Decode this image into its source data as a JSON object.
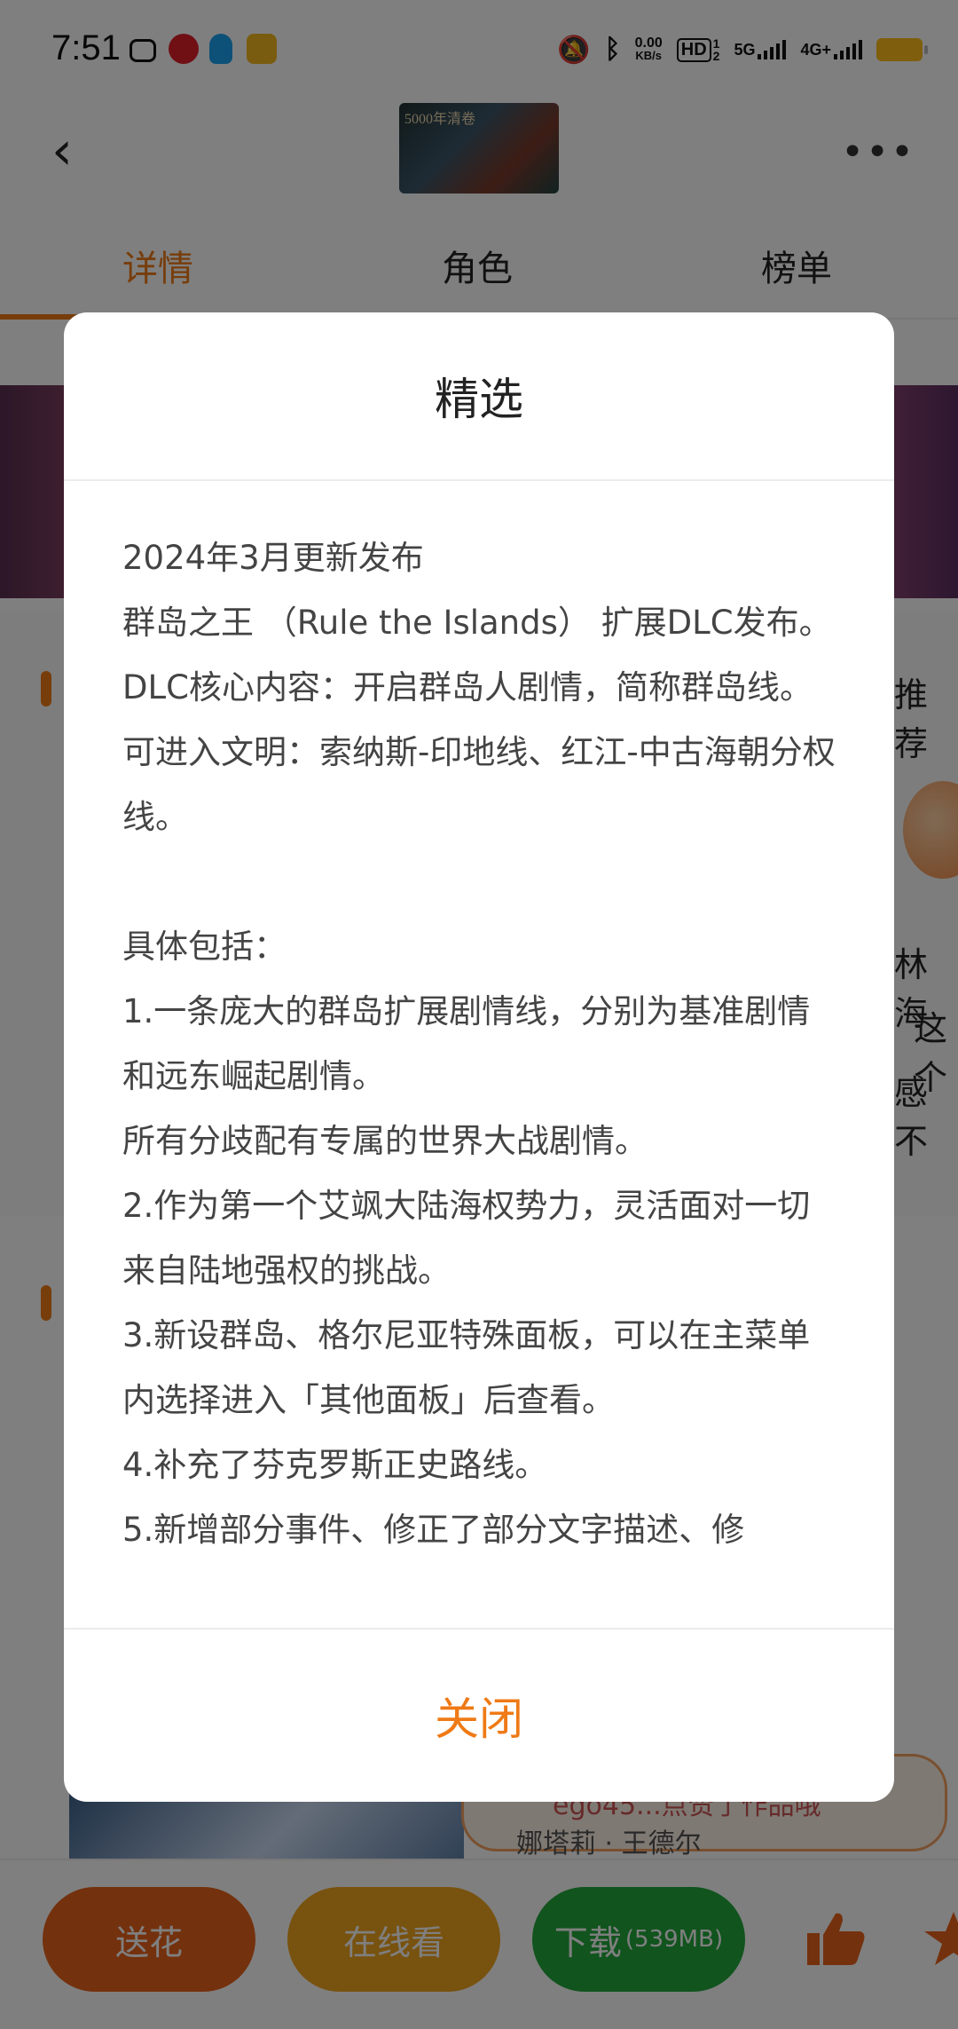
{
  "status_bar": {
    "time": "7:51",
    "net_speed_value": "0.00",
    "net_speed_unit": "KB/s",
    "hd_label": "HD",
    "hd_sub": "1",
    "hd_sub2": "2",
    "net_5g": "5G",
    "net_4g": "4G+",
    "app_icons": [
      "bilibili-icon",
      "netease-music-icon",
      "qq-icon",
      "weibo-icon"
    ],
    "battery_color": "#ffbf1a"
  },
  "header": {
    "cover_text": "5000年清卷"
  },
  "tabs": [
    {
      "label": "详情",
      "active": true
    },
    {
      "label": "角色",
      "active": false
    },
    {
      "label": "榜单",
      "active": false
    }
  ],
  "background": {
    "side_label_1": "推荐",
    "side_name": "林海",
    "side_text_1": "这个",
    "side_text_2": "感不",
    "speech_text": "ego45...点赞了作品哦",
    "under_name": "娜塔莉 · 王德尔"
  },
  "bottom_bar": {
    "flower_label": "送花",
    "watch_label": "在线看",
    "download_label": "下载",
    "download_size": "(539MB)",
    "colors": {
      "flower": "#e8621a",
      "watch": "#f1a51e",
      "download": "#23a83c"
    }
  },
  "dialog": {
    "title": "精选",
    "close_label": "关闭",
    "lines": [
      "2024年3月更新发布",
      "群岛之王 （Rule the Islands） 扩展DLC发布。",
      "DLC核心内容：开启群岛人剧情，简称群岛线。可进入文明：索纳斯-印地线、红江-中古海朝分权线。",
      "",
      "具体包括：",
      "1.一条庞大的群岛扩展剧情线，分别为基准剧情和远东崛起剧情。",
      "所有分歧配有专属的世界大战剧情。",
      "2.作为第一个艾飒大陆海权势力，灵活面对一切来自陆地强权的挑战。",
      "3.新设群岛、格尔尼亚特殊面板，可以在主菜单内选择进入「其他面板」后查看。",
      "4.补充了芬克罗斯正史路线。",
      "5.新增部分事件、修正了部分文字描述、修"
    ],
    "accent_color": "#ef7a16"
  }
}
